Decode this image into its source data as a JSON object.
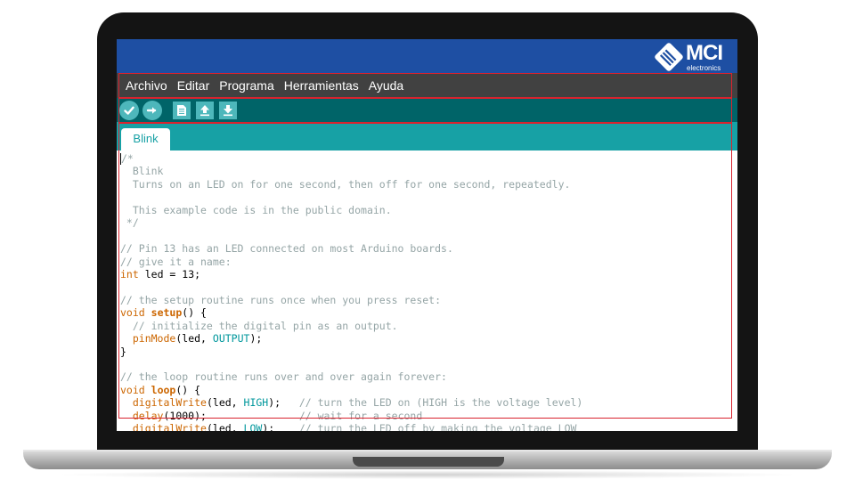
{
  "brand": {
    "logo_text": "MCI",
    "logo_subtext": "electronics"
  },
  "menu": {
    "items": [
      "Archivo",
      "Editar",
      "Programa",
      "Herramientas",
      "Ayuda"
    ]
  },
  "toolbar": {
    "buttons": [
      {
        "icon": "checkmark-icon",
        "action": "Verify"
      },
      {
        "icon": "arrow-right-icon",
        "action": "Upload"
      },
      {
        "icon": "new-file-icon",
        "action": "New"
      },
      {
        "icon": "open-arrow-up-icon",
        "action": "Open"
      },
      {
        "icon": "save-arrow-down-icon",
        "action": "Save"
      }
    ]
  },
  "tabs": [
    {
      "label": "Blink",
      "active": true
    }
  ],
  "code": {
    "lines": [
      "/*",
      "  Blink",
      "  Turns on an LED on for one second, then off for one second, repeatedly.",
      "",
      "  This example code is in the public domain.",
      " */",
      "",
      "// Pin 13 has an LED connected on most Arduino boards.",
      "// give it a name:",
      "int led = 13;",
      "",
      "// the setup routine runs once when you press reset:",
      "void setup() {",
      "  // initialize the digital pin as an output.",
      "  pinMode(led, OUTPUT);",
      "}",
      "",
      "// the loop routine runs over and over again forever:",
      "void loop() {",
      "  digitalWrite(led, HIGH);   // turn the LED on (HIGH is the voltage level)",
      "  delay(1000);               // wait for a second",
      "  digitalWrite(led, LOW);    // turn the LED off by making the voltage LOW"
    ]
  },
  "colors": {
    "brand_bar": "#1e4fa3",
    "menu_bar": "#414141",
    "toolbar": "#006468",
    "toolbar_button": "#4db7bb",
    "tab_strip": "#17a1a5",
    "comment": "#95a5a6",
    "keyword": "#cc6600",
    "constant": "#00979c",
    "annotation": "#d9232e"
  }
}
